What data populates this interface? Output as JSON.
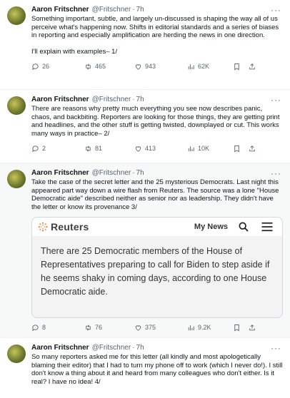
{
  "tweets": [
    {
      "name": "Aaron Fritschner",
      "handle": "@Fritschner",
      "time": "7h",
      "paragraphs": [
        "Something important, subtle, and largely un-discussed is shaping the way all of us perceive what's happening now. Shifts in editorial standards and a series of biases in reporting and especially amplification are herding the news in one direction.",
        "I'll explain with examples– 1/"
      ],
      "replies": "26",
      "reposts": "465",
      "likes": "943",
      "views": "62K"
    },
    {
      "name": "Aaron Fritschner",
      "handle": "@Fritschner",
      "time": "7h",
      "paragraphs": [
        "There are reasons why pretty much everything you see now describes panic, chaos, and backbiting. Reporters are looking for those things, they are getting print and headlines, and the other stuff is getting twisted, downplayed or cut. This works many ways in practice– 2/"
      ],
      "replies": "2",
      "reposts": "81",
      "likes": "413",
      "views": "10K"
    },
    {
      "name": "Aaron Fritschner",
      "handle": "@Fritschner",
      "time": "7h",
      "paragraphs": [
        "Take the case of the secret letter and the 25 mysterious Democrats. Last night this appeared part way down a wire flash from Reuters. The source was a lone \"House Democratic aide\" described neither as senior nor as leadership. They didn't have the letter or know its provenance 3/"
      ],
      "card": {
        "brand": "Reuters",
        "nav_label": "My News",
        "body": "There are 25 Democratic members of the House of Representatives preparing to call for Biden to step aside if he seems shaky in coming days, according to one House Democratic aide."
      },
      "replies": "8",
      "reposts": "76",
      "likes": "375",
      "views": "9.2K"
    },
    {
      "name": "Aaron Fritschner",
      "handle": "@Fritschner",
      "time": "7h",
      "paragraphs": [
        "So many reporters asked me for this letter (all kindly and most apologetically blaming their editor) that I had to turn my phone off to work (which I never do!). I still don't know a thing about it and heard from many colleagues who don't either. Is it real? I have no idea! 4/"
      ]
    }
  ],
  "colors": {
    "text": "#0f1419",
    "muted": "#536471",
    "reuters_orange": "#fb8033"
  }
}
